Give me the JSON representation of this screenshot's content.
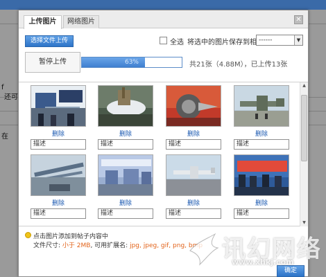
{
  "background": {
    "left_text_1": "f",
    "left_text_2": "还可",
    "left_text_3": "在"
  },
  "dialog": {
    "tabs": [
      {
        "label": "上传图片",
        "active": true
      },
      {
        "label": "网络图片",
        "active": false
      }
    ],
    "close_icon": "close-icon",
    "select_button": "选择文件上传",
    "select_all_label": "全选",
    "save_to_album_label": "将选中的图片保存到相册:",
    "album_select_value": "------",
    "pause_button": "暂停上传",
    "progress": {
      "percent": 63,
      "label": "63%"
    },
    "count_text": "共21张（4.88M），已上传13张",
    "items": [
      {
        "delete": "删除",
        "desc": "描述",
        "scene": "expo-booth"
      },
      {
        "delete": "删除",
        "desc": "描述",
        "scene": "missile-model"
      },
      {
        "delete": "删除",
        "desc": "描述",
        "scene": "jet-engine"
      },
      {
        "delete": "删除",
        "desc": "描述",
        "scene": "transport-plane"
      },
      {
        "delete": "删除",
        "desc": "描述",
        "scene": "aircraft-model"
      },
      {
        "delete": "删除",
        "desc": "描述",
        "scene": "exhibition-hall"
      },
      {
        "delete": "删除",
        "desc": "描述",
        "scene": "airliner"
      },
      {
        "delete": "删除",
        "desc": "描述",
        "scene": "crowd-booth"
      }
    ],
    "tip": "点击图片添加到帖子内容中",
    "size_prefix": "文件尺寸:",
    "size_limit": "小于 2MB",
    "ext_prefix": ", 可用扩展名:",
    "ext_list": "jpg, jpeg, gif, png, bmp",
    "confirm_button": "确定"
  },
  "watermark": {
    "text": "讯幻网络",
    "url": "www.xhkj.com"
  },
  "colors": {
    "accent": "#2d74c8",
    "link": "#1a58b0",
    "warning": "#e2631a"
  }
}
